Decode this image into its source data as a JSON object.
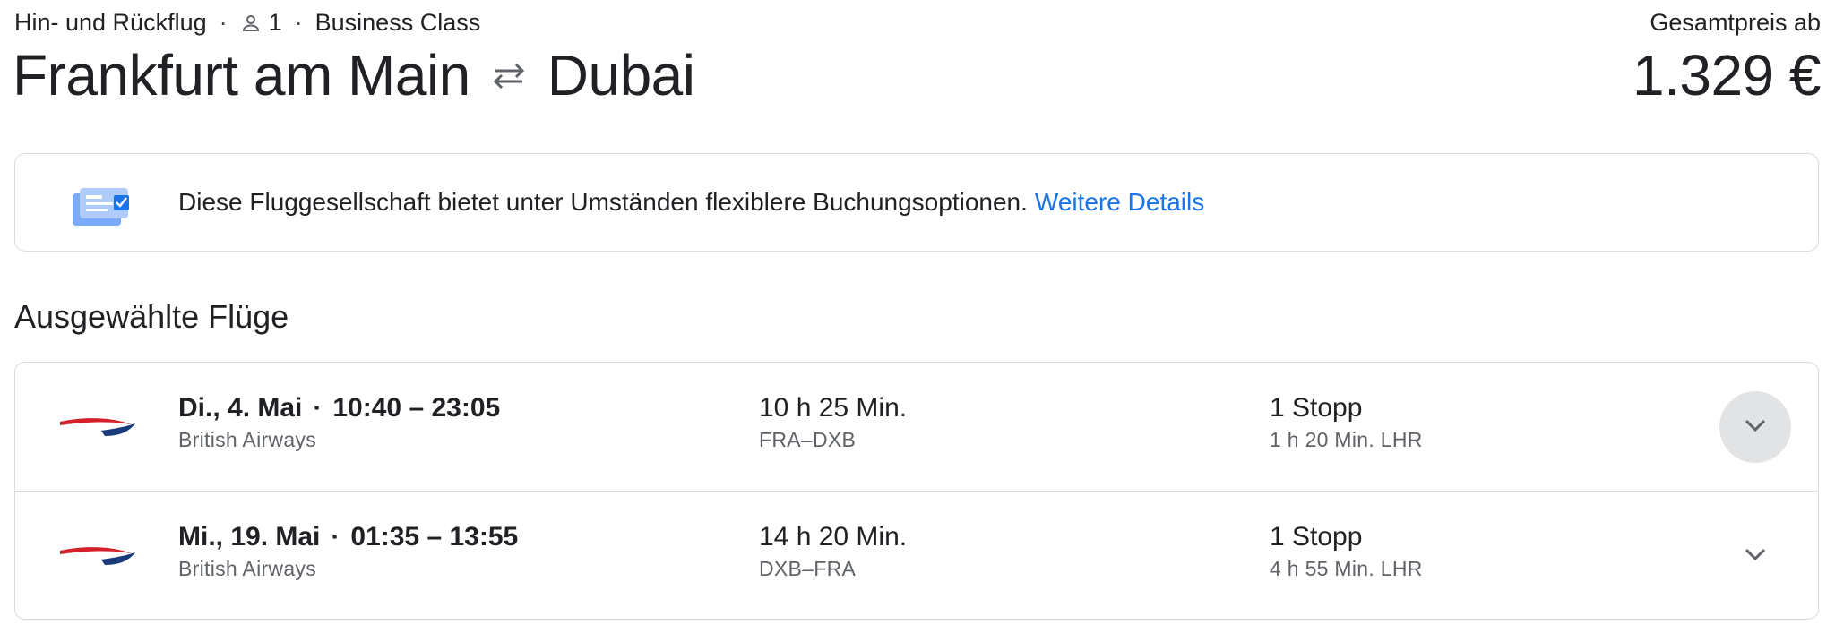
{
  "trip": {
    "type": "Hin- und Rückflug",
    "passengers": "1",
    "cabin": "Business Class",
    "origin": "Frankfurt am Main",
    "destination": "Dubai",
    "swap_icon": "swap-arrows-icon",
    "passenger_icon": "person-icon"
  },
  "price": {
    "label": "Gesamtpreis ab",
    "value": "1.329 €"
  },
  "banner": {
    "icon": "booking-options-icon",
    "text": "Diese Fluggesellschaft bietet unter Umständen flexiblere Buchungsoptionen.",
    "link": "Weitere Details",
    "link_color": "#1a73e8"
  },
  "section_title": "Ausgewählte Flüge",
  "flights": [
    {
      "date": "Di., 4. Mai",
      "times": "10:40 – 23:05",
      "airline": "British Airways",
      "duration": "10 h 25 Min.",
      "route": "FRA–DXB",
      "stops": "1 Stopp",
      "stop_detail": "1 h 20 Min. LHR",
      "expand_icon": "chevron-down-icon"
    },
    {
      "date": "Mi., 19. Mai",
      "times": "01:35 – 13:55",
      "airline": "British Airways",
      "duration": "14 h 20 Min.",
      "route": "DXB–FRA",
      "stops": "1 Stopp",
      "stop_detail": "4 h 55 Min. LHR",
      "expand_icon": "chevron-down-icon"
    }
  ],
  "colors": {
    "text": "#202124",
    "secondary_text": "#5f6368",
    "border": "#dadce0",
    "link": "#1a73e8",
    "ba_red": "#d4202a",
    "ba_navy": "#1b3a7a"
  }
}
